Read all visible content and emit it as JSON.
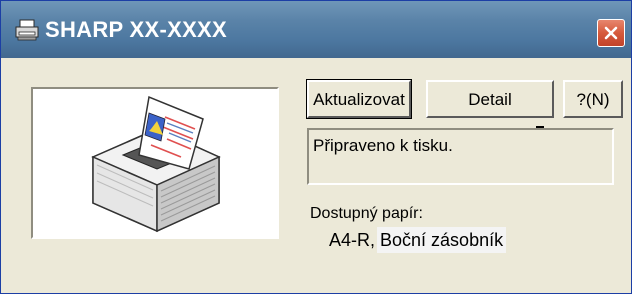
{
  "window": {
    "title": "SHARP XX-XXXX",
    "title_icon": "printer-icon",
    "close_icon": "close-icon"
  },
  "buttons": {
    "update": "Aktualizovat",
    "detail": "Detail",
    "help": "?(N)"
  },
  "status": {
    "text": "Připraveno k tisku."
  },
  "paper": {
    "label": "Dostupný papír:",
    "size": "A4-R,",
    "tray": "Boční zásobník"
  },
  "illustration": {
    "icon": "printer-icon"
  },
  "colors": {
    "titlebar": "#5a83a8",
    "close_button": "#d65a3c",
    "face": "#ece9d8"
  }
}
